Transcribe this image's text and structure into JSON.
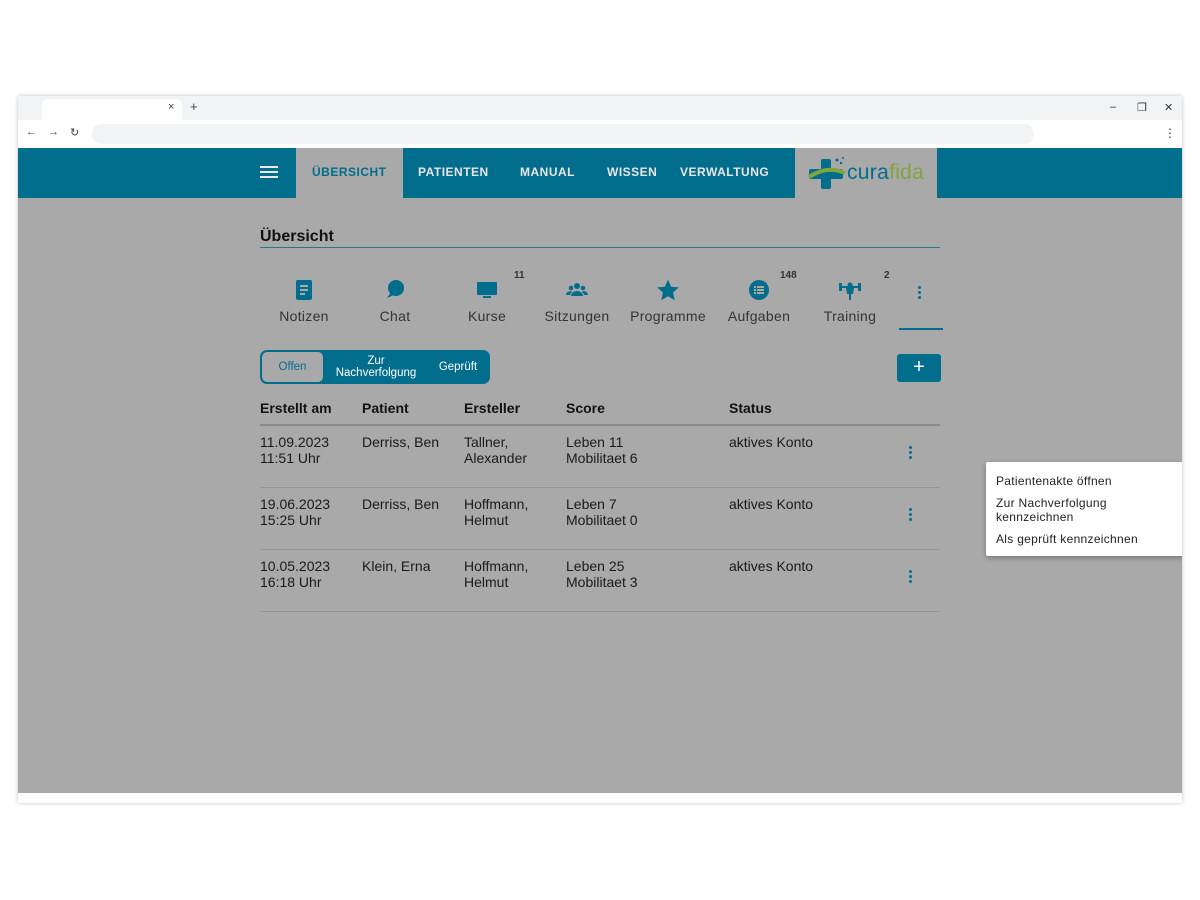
{
  "browser": {
    "close_tab": "×",
    "new_tab": "+",
    "minimize": "–",
    "restore": "❐",
    "close_window": "✕",
    "back": "←",
    "forward": "→",
    "reload": "↻",
    "menu": "⋮"
  },
  "nav": {
    "items": [
      {
        "label": "ÜBERSICHT",
        "active": true
      },
      {
        "label": "PATIENTEN",
        "active": false
      },
      {
        "label": "MANUAL",
        "active": false
      },
      {
        "label": "WISSEN",
        "active": false
      },
      {
        "label": "VERWALTUNG",
        "active": false
      }
    ],
    "logo": {
      "part1": "cura",
      "part2": "fida"
    }
  },
  "page": {
    "title": "Übersicht"
  },
  "sections": [
    {
      "label": "Notizen",
      "icon": "note-icon",
      "badge": ""
    },
    {
      "label": "Chat",
      "icon": "chat-icon",
      "badge": ""
    },
    {
      "label": "Kurse",
      "icon": "monitor-icon",
      "badge": "11"
    },
    {
      "label": "Sitzungen",
      "icon": "group-icon",
      "badge": ""
    },
    {
      "label": "Programme",
      "icon": "star-icon",
      "badge": ""
    },
    {
      "label": "Aufgaben",
      "icon": "list-icon",
      "badge": "148"
    },
    {
      "label": "Training",
      "icon": "weightlifter-icon",
      "badge": "2"
    }
  ],
  "filter": {
    "open": "Offen",
    "followup_line1": "Zur",
    "followup_line2": "Nachverfolgung",
    "checked": "Geprüft"
  },
  "add_button": "+",
  "table": {
    "headers": [
      "Erstellt am",
      "Patient",
      "Ersteller",
      "Score",
      "Status"
    ],
    "rows": [
      {
        "date": "11.09.2023",
        "time": "11:51 Uhr",
        "patient": "Derriss, Ben",
        "creator1": "Tallner,",
        "creator2": "Alexander",
        "score1": "Leben 11",
        "score2": "Mobilitaet 6",
        "status": "aktives Konto"
      },
      {
        "date": "19.06.2023",
        "time": "15:25 Uhr",
        "patient": "Derriss, Ben",
        "creator1": "Hoffmann,",
        "creator2": "Helmut",
        "score1": "Leben 7",
        "score2": "Mobilitaet 0",
        "status": "aktives Konto"
      },
      {
        "date": "10.05.2023",
        "time": "16:18 Uhr",
        "patient": "Klein, Erna",
        "creator1": "Hoffmann,",
        "creator2": "Helmut",
        "score1": "Leben 25",
        "score2": "Mobilitaet 3",
        "status": "aktives Konto"
      }
    ]
  },
  "context_menu": {
    "open_record": "Patientenakte öffnen",
    "mark_followup_1": "Zur Nachverfolgung",
    "mark_followup_2": "kennzeichnen",
    "mark_checked": "Als geprüft kennzeichnen"
  },
  "colors": {
    "primary": "#006d8c",
    "logo_green": "#7fa53d",
    "overlay": "#a9a9a9"
  }
}
